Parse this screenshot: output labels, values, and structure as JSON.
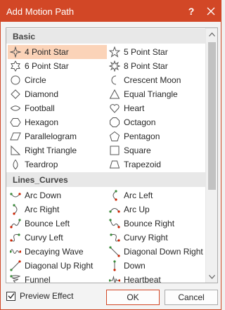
{
  "window": {
    "title": "Add Motion Path",
    "help_glyph": "?",
    "accent_color": "#d24726"
  },
  "list": {
    "sections": [
      {
        "header": "Basic",
        "items": [
          {
            "label": "4 Point Star",
            "icon": "four-point-star-icon",
            "selected": true
          },
          {
            "label": "5 Point Star",
            "icon": "five-point-star-icon"
          },
          {
            "label": "6 Point Star",
            "icon": "six-point-star-icon"
          },
          {
            "label": "8 Point Star",
            "icon": "eight-point-star-icon"
          },
          {
            "label": "Circle",
            "icon": "circle-icon"
          },
          {
            "label": "Crescent Moon",
            "icon": "crescent-moon-icon"
          },
          {
            "label": "Diamond",
            "icon": "diamond-icon"
          },
          {
            "label": "Equal Triangle",
            "icon": "equal-triangle-icon"
          },
          {
            "label": "Football",
            "icon": "football-icon"
          },
          {
            "label": "Heart",
            "icon": "heart-icon"
          },
          {
            "label": "Hexagon",
            "icon": "hexagon-icon"
          },
          {
            "label": "Octagon",
            "icon": "octagon-icon"
          },
          {
            "label": "Parallelogram",
            "icon": "parallelogram-icon"
          },
          {
            "label": "Pentagon",
            "icon": "pentagon-icon"
          },
          {
            "label": "Right Triangle",
            "icon": "right-triangle-icon"
          },
          {
            "label": "Square",
            "icon": "square-icon"
          },
          {
            "label": "Teardrop",
            "icon": "teardrop-icon"
          },
          {
            "label": "Trapezoid",
            "icon": "trapezoid-icon"
          }
        ]
      },
      {
        "header": "Lines_Curves",
        "items": [
          {
            "label": "Arc Down",
            "icon": "arc-down-icon"
          },
          {
            "label": "Arc Left",
            "icon": "arc-left-icon"
          },
          {
            "label": "Arc Right",
            "icon": "arc-right-icon"
          },
          {
            "label": "Arc Up",
            "icon": "arc-up-icon"
          },
          {
            "label": "Bounce Left",
            "icon": "bounce-left-icon"
          },
          {
            "label": "Bounce Right",
            "icon": "bounce-right-icon"
          },
          {
            "label": "Curvy Left",
            "icon": "curvy-left-icon"
          },
          {
            "label": "Curvy Right",
            "icon": "curvy-right-icon"
          },
          {
            "label": "Decaying Wave",
            "icon": "decaying-wave-icon"
          },
          {
            "label": "Diagonal Down Right",
            "icon": "diagonal-down-right-icon"
          },
          {
            "label": "Diagonal Up Right",
            "icon": "diagonal-up-right-icon"
          },
          {
            "label": "Down",
            "icon": "down-icon"
          },
          {
            "label": "Funnel",
            "icon": "funnel-icon"
          },
          {
            "label": "Heartbeat",
            "icon": "heartbeat-icon"
          }
        ]
      }
    ]
  },
  "footer": {
    "preview_label": "Preview Effect",
    "preview_checked": true,
    "ok_label": "OK",
    "cancel_label": "Cancel"
  }
}
